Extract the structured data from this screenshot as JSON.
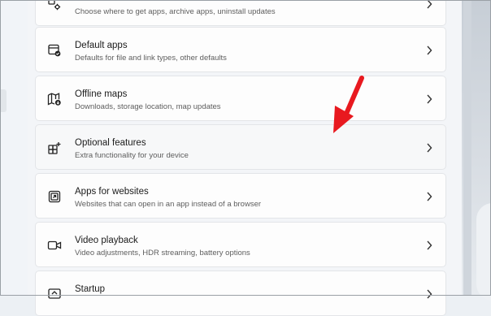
{
  "cards": [
    {
      "title": "",
      "description": "Choose where to get apps, archive apps, uninstall updates",
      "icon": "apps-settings-icon"
    },
    {
      "title": "Default apps",
      "description": "Defaults for file and link types, other defaults",
      "icon": "default-apps-icon"
    },
    {
      "title": "Offline maps",
      "description": "Downloads, storage location, map updates",
      "icon": "offline-maps-icon"
    },
    {
      "title": "Optional features",
      "description": "Extra functionality for your device",
      "icon": "optional-features-icon"
    },
    {
      "title": "Apps for websites",
      "description": "Websites that can open in an app instead of a browser",
      "icon": "apps-for-websites-icon"
    },
    {
      "title": "Video playback",
      "description": "Video adjustments, HDR streaming, battery options",
      "icon": "video-playback-icon"
    },
    {
      "title": "Startup",
      "description": "",
      "icon": "startup-icon"
    }
  ],
  "annotation": {
    "arrow_color": "#e8191f",
    "points_to": "Optional features"
  }
}
